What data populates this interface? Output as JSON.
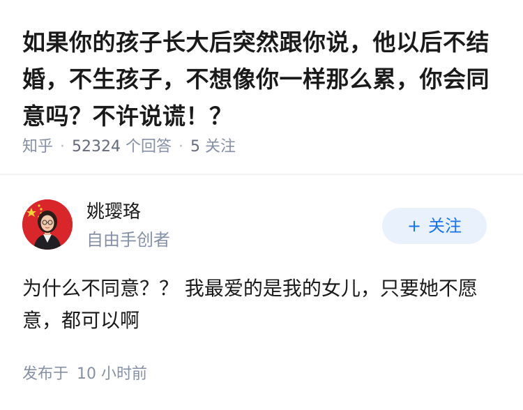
{
  "question": {
    "title": "如果你的孩子长大后突然跟你说，他以后不结婚，不生孩子，不想像你一样那么累，你会同意吗？不许说谎！？"
  },
  "meta": {
    "source": "知乎",
    "answer_count": "52324",
    "answer_label": "个回答",
    "follower_count": "5",
    "follower_label": "关注"
  },
  "author": {
    "name": "姚璎珞",
    "bio": "自由手创者",
    "avatar_icon": "person-avatar-icon",
    "avatar_bg": "#d8262a"
  },
  "follow_button": {
    "plus": "+",
    "label": "关注"
  },
  "answer": {
    "text": "为什么不同意？？ 我最爱的是我的女儿，只要她不愿意，都可以啊"
  },
  "footer": {
    "published_label": "发布于",
    "time": "10 小时前"
  },
  "colors": {
    "accent": "#1772f6",
    "muted": "#8590a6",
    "text": "#1a1a1a"
  }
}
